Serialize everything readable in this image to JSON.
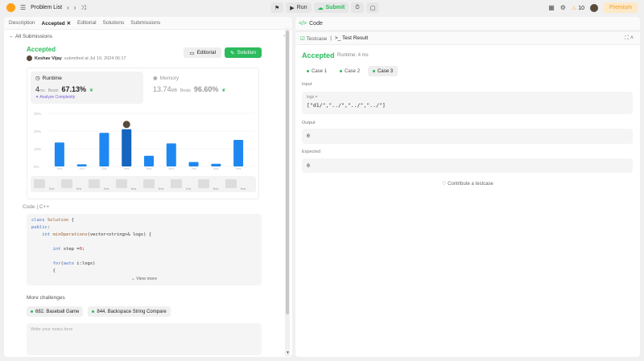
{
  "topbar": {
    "problem_list": "Problem List",
    "run": "Run",
    "submit": "Submit",
    "streak": "10",
    "premium": "Premium"
  },
  "left": {
    "tabs": [
      "Description",
      "Accepted",
      "Editorial",
      "Solutions",
      "Submissions"
    ],
    "all_submissions": "All Submissions",
    "status": "Accepted",
    "author": "Keshav Vijay",
    "submitted": "submitted at Jul 10, 2024 06:17",
    "editorial_btn": "Editorial",
    "solution_btn": "Solution",
    "runtime": {
      "label": "Runtime",
      "value": "4",
      "unit": "ms",
      "beats_label": "Beats",
      "beats": "67.13%",
      "analyze": "Analyze Complexity"
    },
    "memory": {
      "label": "Memory",
      "value": "13.74",
      "unit": "MB",
      "beats_label": "Beats",
      "beats": "96.60%"
    },
    "code_header": [
      "Code",
      "C++"
    ],
    "code_lines": [
      "class Solution {",
      "public:",
      "    int minOperations(vector<string>& logs) {",
      "",
      "        int step =0;",
      "",
      "        for(auto i:logs)",
      "        {"
    ],
    "view_more": "View more",
    "more_challenges": "More challenges",
    "challenges": [
      "682. Baseball Game",
      "844. Backspace String Compare"
    ],
    "notes_placeholder": "Write your notes here"
  },
  "chart_data": {
    "type": "bar",
    "ylabels": [
      "30%",
      "20%",
      "10%",
      "0%"
    ],
    "ylim": [
      0,
      30
    ],
    "categories": [
      "0ms",
      "1ms",
      "2ms",
      "4ms",
      "5ms",
      "6ms",
      "7ms",
      "8ms",
      "9ms"
    ],
    "values": [
      13.5,
      1.2,
      19,
      21,
      6,
      13,
      2.5,
      1.5,
      15
    ],
    "highlight_index": 3,
    "xticks": [
      "2ms",
      "5ms",
      "3ms",
      "6ms",
      "8ms",
      "1ms",
      "8ms",
      "5ms"
    ],
    "colors": {
      "bar": "#1e88f0",
      "highlight": "#1565c0"
    }
  },
  "right": {
    "code_title": "Code",
    "tabs": [
      "Testcase",
      "Test Result"
    ],
    "status": "Accepted",
    "runtime": "Runtime: 4 ms",
    "cases": [
      "Case 1",
      "Case 2",
      "Case 3"
    ],
    "input_label": "Input",
    "var": "logs =",
    "input": "[\"d1/\",\"../\",\"../\",\"../\"]",
    "output_label": "Output",
    "output": "0",
    "expected_label": "Expected",
    "expected": "0",
    "contribute": "Contribute a testcase"
  }
}
